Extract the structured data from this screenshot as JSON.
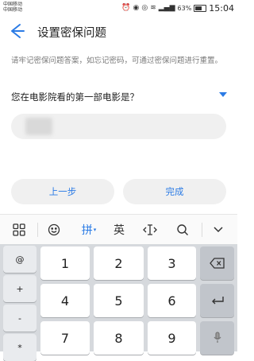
{
  "status_bar": {
    "carrier1": "中国移动",
    "carrier2": "中国移动",
    "battery": "63%",
    "time": "15:04"
  },
  "app_bar": {
    "title": "设置密保问题"
  },
  "content": {
    "hint": "请牢记密保问题答案，如忘记密码，可通过密保问题进行重置。",
    "question": "您在电影院看的第一部电影是？",
    "answer_value": ""
  },
  "buttons": {
    "prev": "上一步",
    "done": "完成"
  },
  "ime": {
    "pinyin": "拼",
    "english": "英"
  },
  "keyboard": {
    "side_keys": [
      "@",
      "+",
      "-",
      "*"
    ],
    "digits": [
      "1",
      "2",
      "3",
      "4",
      "5",
      "6",
      "7",
      "8",
      "9"
    ]
  },
  "icons": {
    "back": "arrow-left-icon",
    "grid": "grid-icon",
    "emoji": "emoji-icon",
    "cursor": "cursor-icon",
    "search": "search-icon",
    "collapse": "chevron-down-icon",
    "backspace": "backspace-icon",
    "enter": "enter-icon",
    "mic": "mic-icon"
  },
  "colors": {
    "accent": "#2b7be5",
    "keyboard_bg": "#d6d9dd"
  }
}
